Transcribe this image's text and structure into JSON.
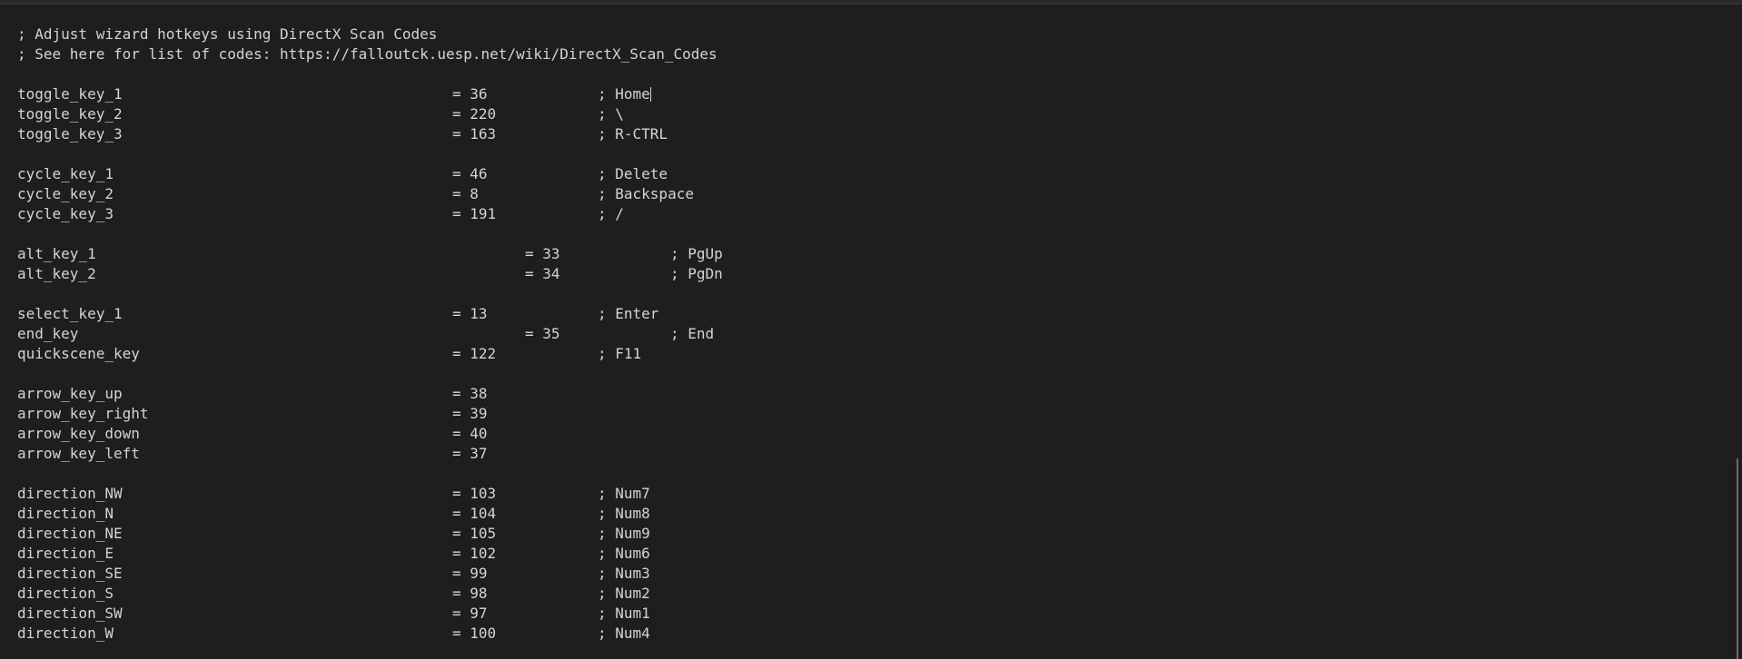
{
  "editor": {
    "lines": [
      {
        "type": "comment",
        "text": "; Adjust wizard hotkeys using DirectX Scan Codes"
      },
      {
        "type": "comment",
        "text": "; See here for list of codes: https://falloutck.uesp.net/wiki/DirectX_Scan_Codes"
      },
      {
        "type": "blank"
      },
      {
        "type": "entry",
        "key": "toggle_key_1",
        "eq": "= 36",
        "comment": "; Home",
        "cursor": true
      },
      {
        "type": "entry",
        "key": "toggle_key_2",
        "eq": "= 220",
        "comment": "; \\"
      },
      {
        "type": "entry",
        "key": "toggle_key_3",
        "eq": "= 163",
        "comment": "; R-CTRL"
      },
      {
        "type": "blank"
      },
      {
        "type": "entry",
        "key": "cycle_key_1",
        "eq": "= 46",
        "comment": "; Delete"
      },
      {
        "type": "entry",
        "key": "cycle_key_2",
        "eq": "= 8",
        "comment": "; Backspace"
      },
      {
        "type": "entry",
        "key": "cycle_key_3",
        "eq": "= 191",
        "comment": "; /"
      },
      {
        "type": "blank"
      },
      {
        "type": "entry",
        "key": "alt_key_1",
        "eq": "= 33",
        "comment": "; PgUp",
        "late": true
      },
      {
        "type": "entry",
        "key": "alt_key_2",
        "eq": "= 34",
        "comment": "; PgDn",
        "late": true
      },
      {
        "type": "blank"
      },
      {
        "type": "entry",
        "key": "select_key_1",
        "eq": "= 13",
        "comment": "; Enter"
      },
      {
        "type": "entry",
        "key": "end_key",
        "eq": "= 35",
        "comment": "; End",
        "late": true
      },
      {
        "type": "entry",
        "key": "quickscene_key",
        "eq": "= 122",
        "comment": "; F11"
      },
      {
        "type": "blank"
      },
      {
        "type": "entry",
        "key": "arrow_key_up",
        "eq": "= 38",
        "comment": ""
      },
      {
        "type": "entry",
        "key": "arrow_key_right",
        "eq": "= 39",
        "comment": ""
      },
      {
        "type": "entry",
        "key": "arrow_key_down",
        "eq": "= 40",
        "comment": ""
      },
      {
        "type": "entry",
        "key": "arrow_key_left",
        "eq": "= 37",
        "comment": ""
      },
      {
        "type": "blank"
      },
      {
        "type": "entry",
        "key": "direction_NW",
        "eq": "= 103",
        "comment": "; Num7"
      },
      {
        "type": "entry",
        "key": "direction_N",
        "eq": "= 104",
        "comment": "; Num8"
      },
      {
        "type": "entry",
        "key": "direction_NE",
        "eq": "= 105",
        "comment": "; Num9"
      },
      {
        "type": "entry",
        "key": "direction_E",
        "eq": "= 102",
        "comment": "; Num6"
      },
      {
        "type": "entry",
        "key": "direction_SE",
        "eq": "= 99",
        "comment": "; Num3"
      },
      {
        "type": "entry",
        "key": "direction_S",
        "eq": "= 98",
        "comment": "; Num2"
      },
      {
        "type": "entry",
        "key": "direction_SW",
        "eq": "= 97",
        "comment": "; Num1"
      },
      {
        "type": "entry",
        "key": "direction_W",
        "eq": "= 100",
        "comment": "; Num4"
      }
    ]
  },
  "colors": {
    "background": "#1e1e1e",
    "text": "#d4d4d4",
    "scrollbar": "#6a6a6a"
  }
}
